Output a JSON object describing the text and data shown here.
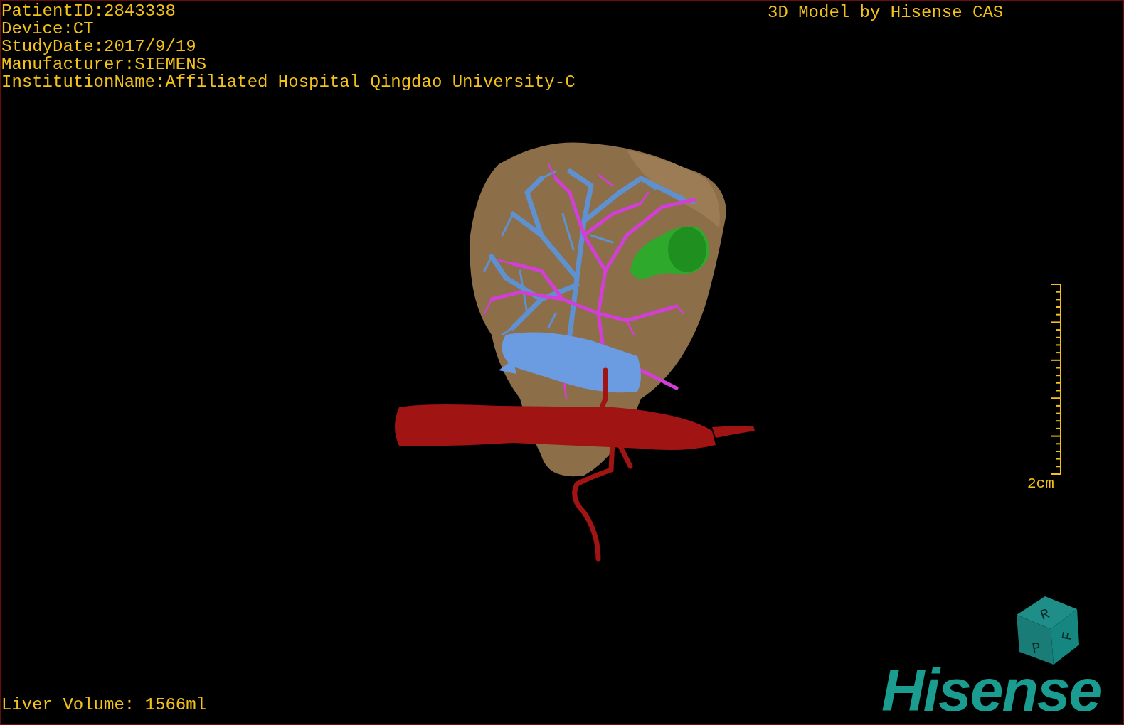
{
  "patient_info": [
    "PatientID:2843338",
    "Device:CT",
    "StudyDate:2017/9/19",
    "Manufacturer:SIEMENS",
    "InstitutionName:Affiliated Hospital Qingdao University-C"
  ],
  "title": "3D Model by Hisense CAS",
  "scale_bar": {
    "label": "2cm"
  },
  "orientation_cube": {
    "labels": [
      "R",
      "F",
      "P"
    ]
  },
  "liver_volume": "Liver Volume: 1566ml",
  "logo": "Hisense"
}
